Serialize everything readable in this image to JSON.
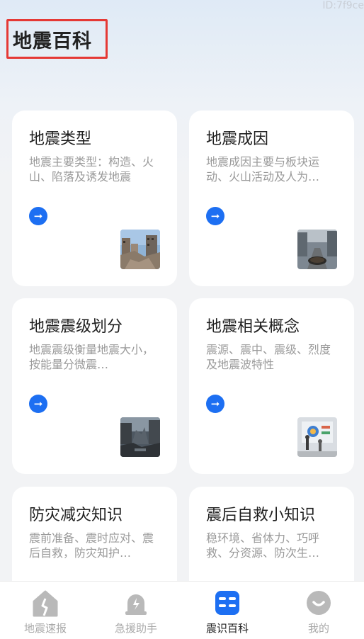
{
  "watermark": "ID:7f9ce",
  "header": {
    "title": "地震百科"
  },
  "cards": [
    {
      "title": "地震类型",
      "desc": "地震主要类型：构造、火山、陷落及诱发地震",
      "thumb": "collapsed-buildings-photo"
    },
    {
      "title": "地震成因",
      "desc": "地震成因主要与板块运动、火山活动及人为…",
      "thumb": "cracked-street-photo"
    },
    {
      "title": "地震震级划分",
      "desc": "地震震级衡量地震大小，按能量分微震…",
      "thumb": "ruined-city-photo"
    },
    {
      "title": "地震相关概念",
      "desc": "震源、震中、震级、烈度及地震波特性",
      "thumb": "science-exhibit-photo"
    },
    {
      "title": "防灾减灾知识",
      "desc": "震前准备、震时应对、震后自救，防灾知护…",
      "thumb": ""
    },
    {
      "title": "震后自救小知识",
      "desc": "稳环境、省体力、巧呼救、分资源、防次生…",
      "thumb": ""
    }
  ],
  "tabs": [
    {
      "label": "地震速报",
      "icon": "house-crack-icon",
      "active": false
    },
    {
      "label": "急援助手",
      "icon": "alarm-bell-icon",
      "active": false
    },
    {
      "label": "震识百科",
      "icon": "encyclopedia-icon",
      "active": true
    },
    {
      "label": "我的",
      "icon": "profile-icon",
      "active": false
    }
  ],
  "colors": {
    "accent": "#1d6ff2",
    "highlight_border": "#e53935",
    "tab_inactive": "#a8a8a8"
  }
}
